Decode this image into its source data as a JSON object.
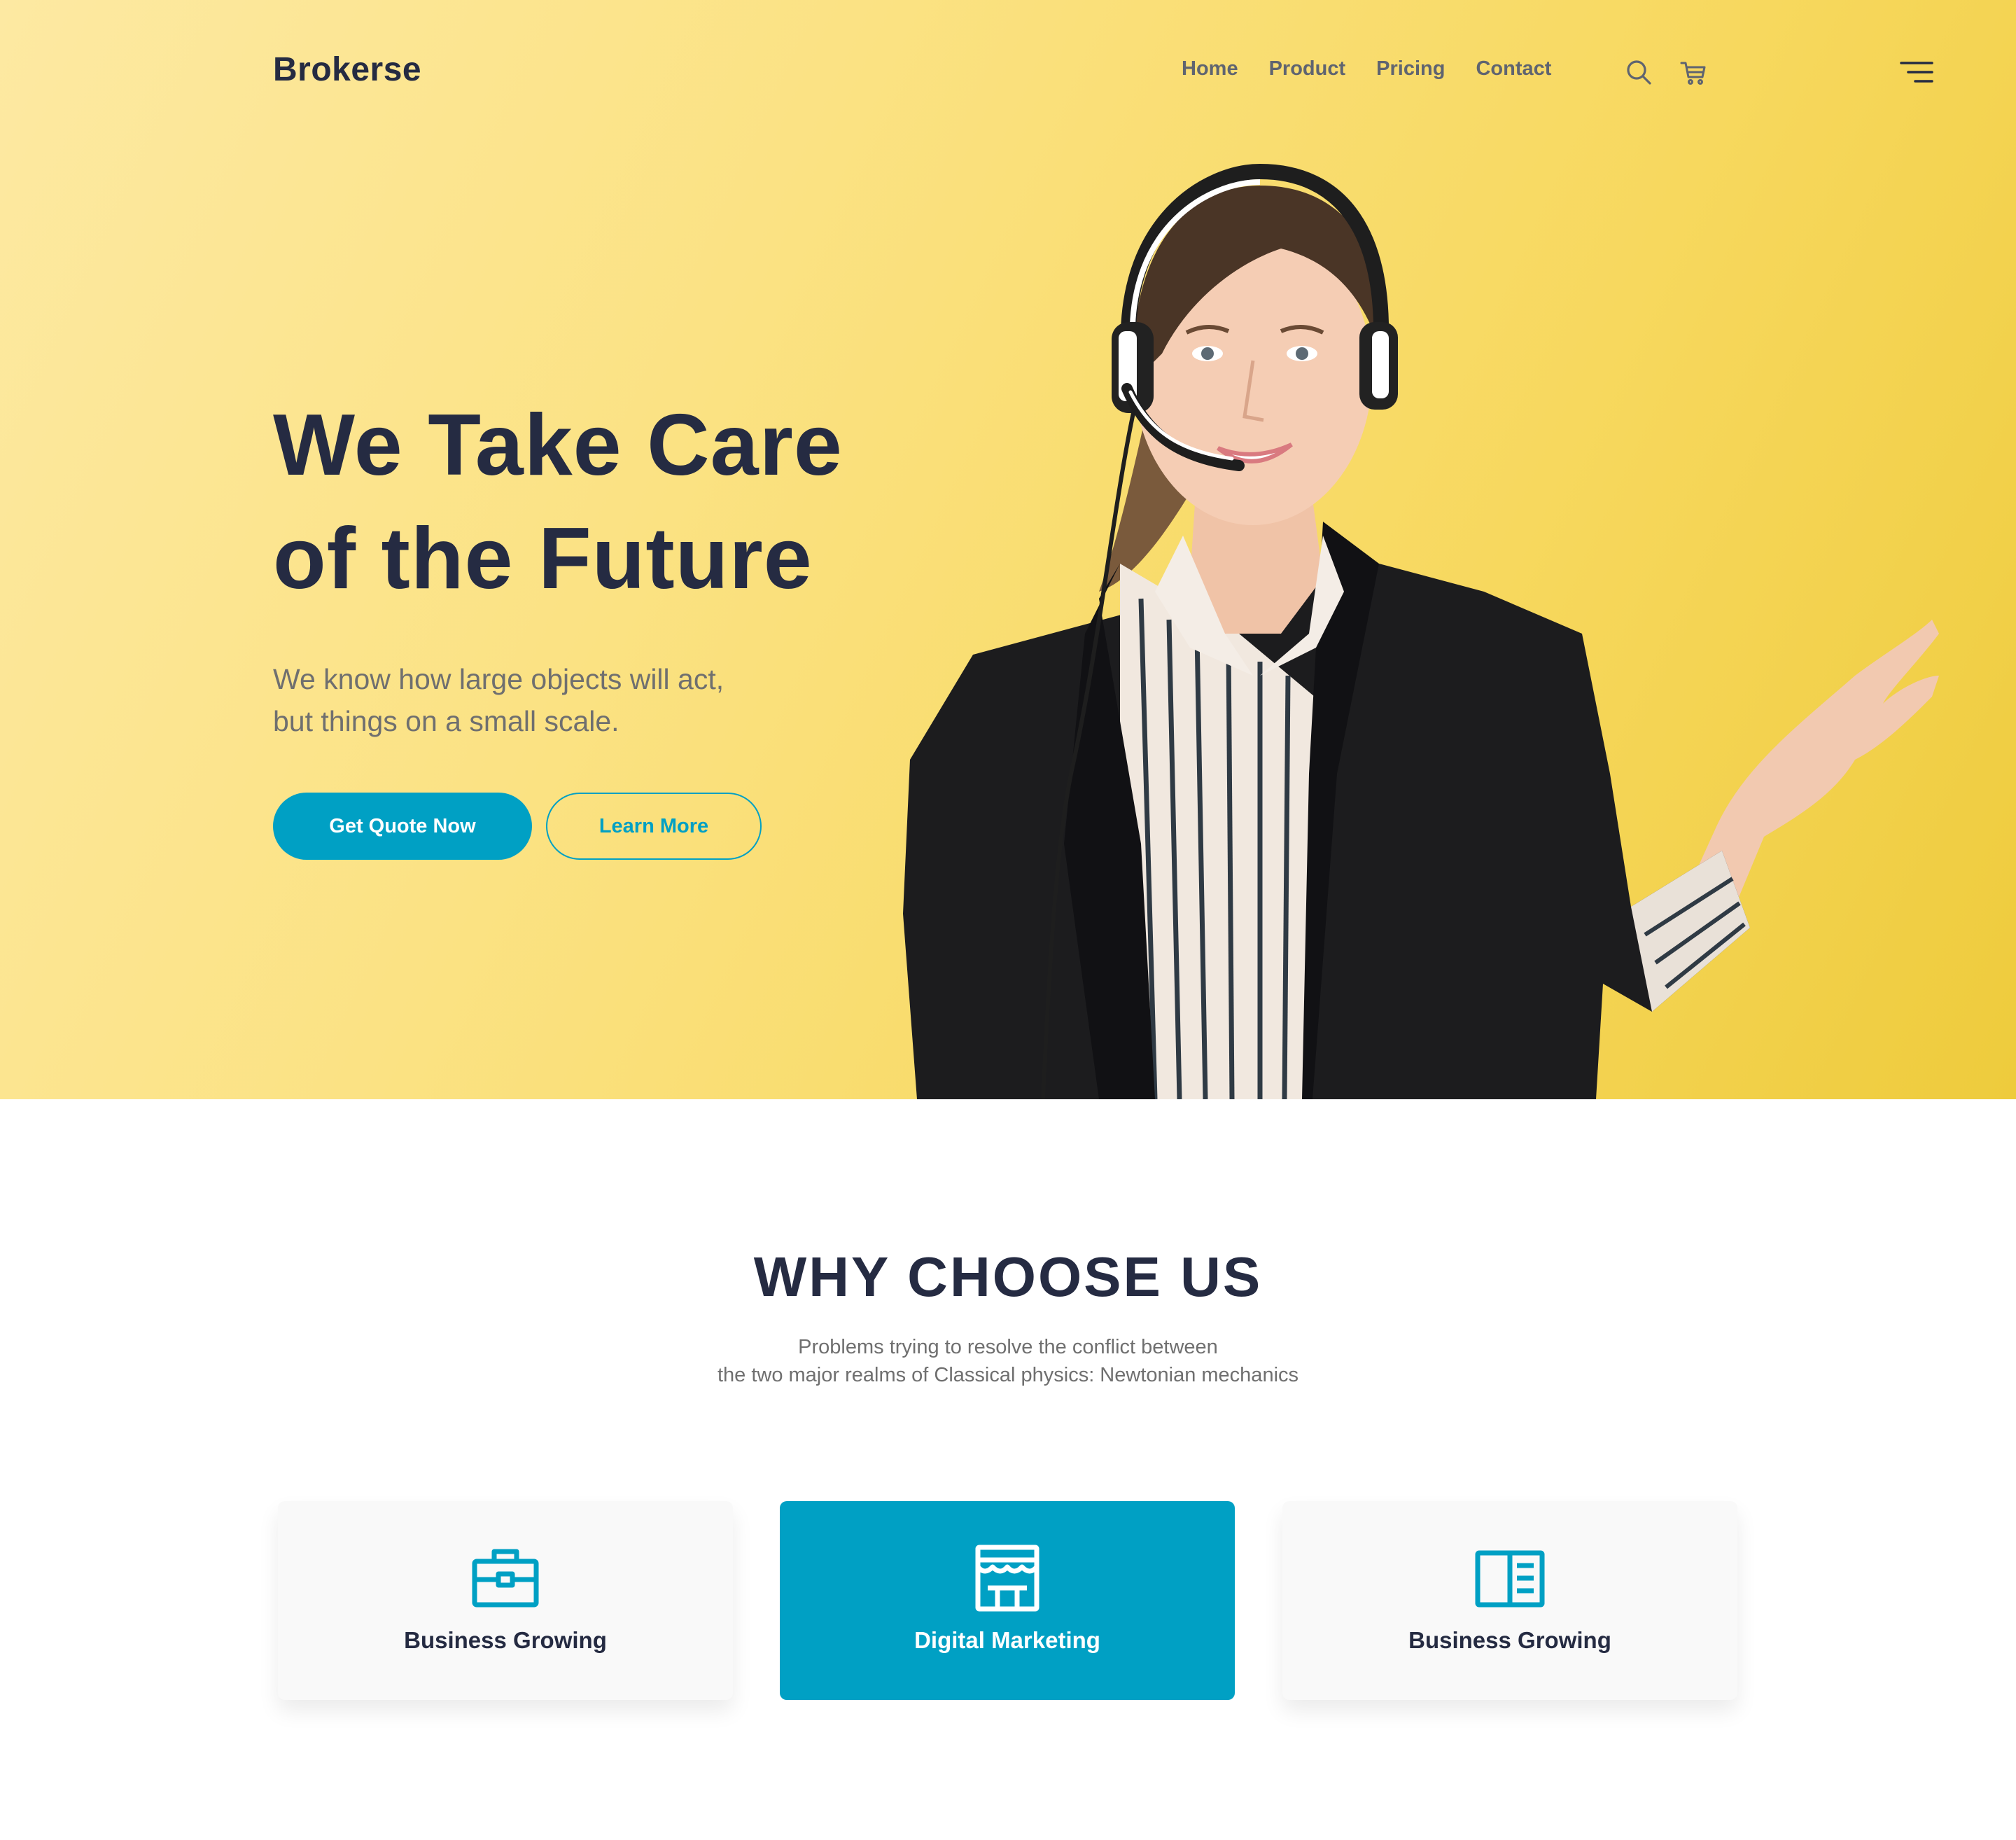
{
  "header": {
    "brand": "Brokerse",
    "nav": [
      "Home",
      "Product",
      "Pricing",
      "Contact"
    ],
    "icons": [
      "search-icon",
      "cart-icon",
      "menu-icon"
    ]
  },
  "hero": {
    "title_line1": "We Take Care",
    "title_line2": "of the Future",
    "subtitle_line1": "We know how large objects will act,",
    "subtitle_line2": "but things on a small scale.",
    "primary_button": "Get Quote Now",
    "secondary_button": "Learn More",
    "image": "support-agent-with-headset-photo"
  },
  "why": {
    "title": "WHY CHOOSE US",
    "subtitle_line1": "Problems trying to resolve the conflict between",
    "subtitle_line2": "the two major realms of Classical physics: Newtonian mechanics",
    "cards": [
      {
        "title": "Business Growing",
        "icon": "briefcase-icon",
        "active": false
      },
      {
        "title": "Digital Marketing",
        "icon": "storefront-icon",
        "active": true
      },
      {
        "title": "Business Growing",
        "icon": "book-open-icon",
        "active": false
      }
    ]
  },
  "colors": {
    "accent": "#00a0c4",
    "heading": "#252b42",
    "muted": "#6f6f6f",
    "hero_bg": "#f9dd6a",
    "card_bg": "#f9f9f9"
  }
}
